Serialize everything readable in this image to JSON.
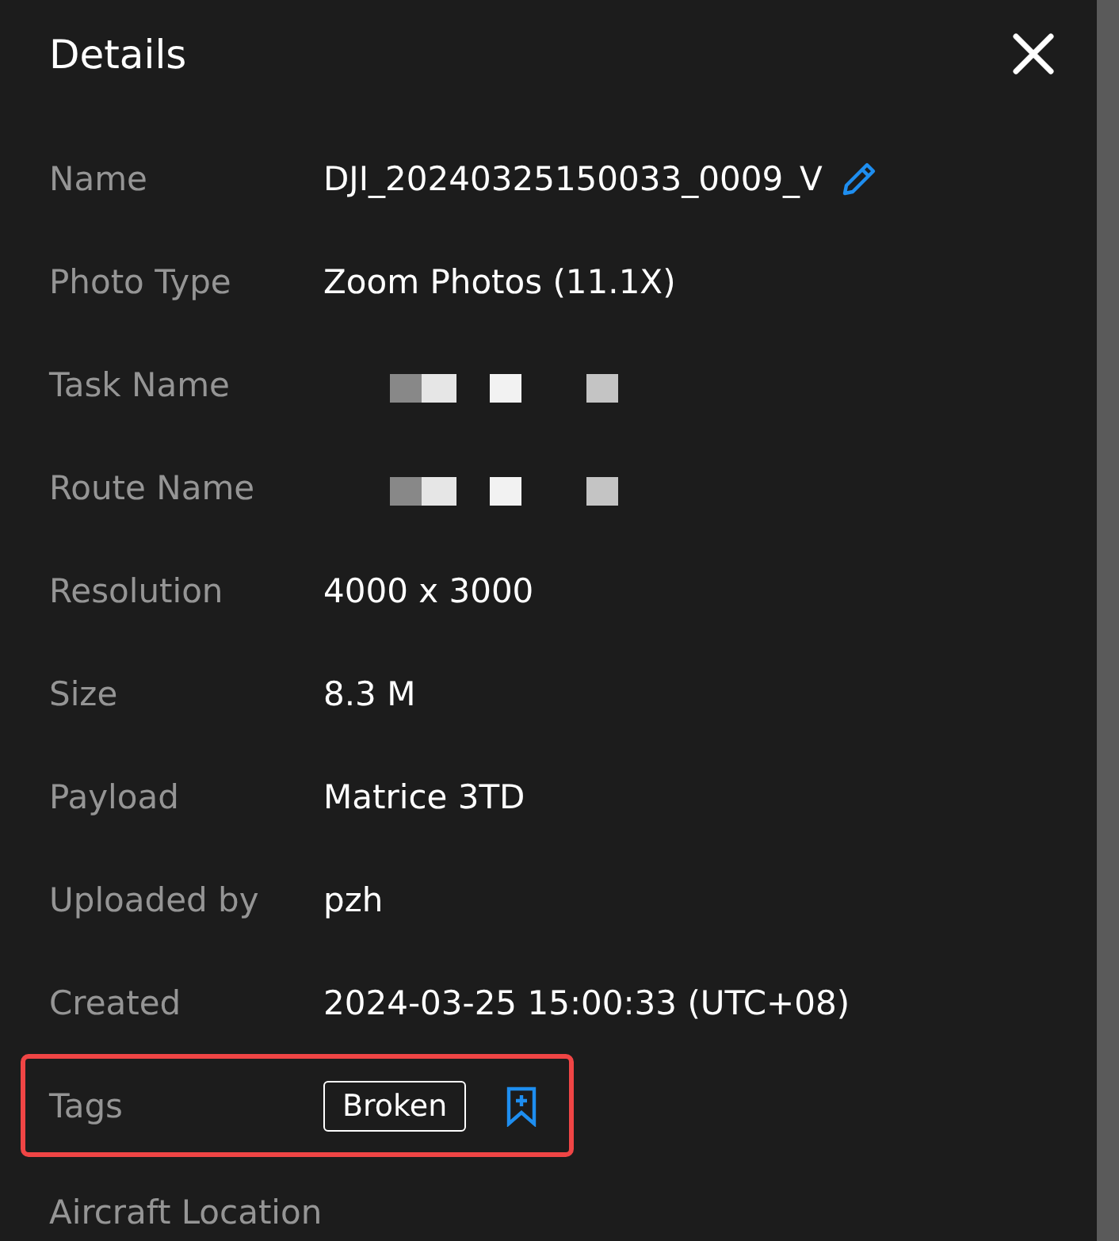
{
  "title": "Details",
  "fields": [
    {
      "kind": "editable",
      "label": "Name",
      "value": "DJI_20240325150033_0009_V"
    },
    {
      "kind": "text",
      "label": "Photo Type",
      "value": "Zoom Photos (11.1X)"
    },
    {
      "kind": "redacted",
      "label": "Task Name"
    },
    {
      "kind": "redacted",
      "label": "Route Name"
    },
    {
      "kind": "text",
      "label": "Resolution",
      "value": "4000 x 3000"
    },
    {
      "kind": "text",
      "label": "Size",
      "value": "8.3 M"
    },
    {
      "kind": "text",
      "label": "Payload",
      "value": "Matrice 3TD"
    },
    {
      "kind": "text",
      "label": "Uploaded by",
      "value": "pzh"
    },
    {
      "kind": "text",
      "label": "Created",
      "value": "2024-03-25 15:00:33 (UTC+08)"
    },
    {
      "kind": "tags",
      "label": "Tags",
      "tags": [
        "Broken"
      ],
      "highlighted": true
    },
    {
      "kind": "text",
      "label": "Aircraft Location"
    }
  ]
}
